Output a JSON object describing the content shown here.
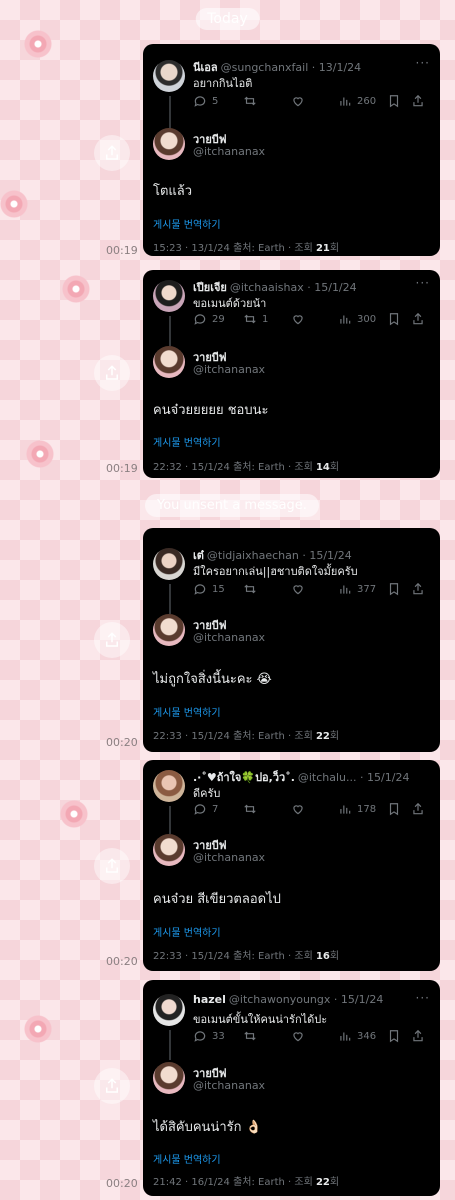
{
  "date_divider": "Today",
  "unsent_notice": "You unsent a message.",
  "cards": [
    {
      "time": "00:19",
      "quoted": {
        "name": "นีเอล",
        "handle": "@sungchanxfail",
        "date": "13/1/24",
        "text": "อยากกินไอติ",
        "replies": "5",
        "retweets": "",
        "views": "260"
      },
      "reply": {
        "name": "วายบีฟ",
        "handle": "@itchananax",
        "text": "โตแล้ว",
        "translate": "게시물 번역하기",
        "meta_prefix": "15:23 · 13/1/24 출처: Earth · 조회 ",
        "views": "21",
        "meta_suffix": "회"
      }
    },
    {
      "time": "00:19",
      "quoted": {
        "name": "เปียเจีย",
        "handle": "@itchaaishax",
        "date": "15/1/24",
        "text": "ขอเมนต์ด้วยน้า",
        "replies": "29",
        "retweets": "1",
        "views": "300"
      },
      "reply": {
        "name": "วายบีฟ",
        "handle": "@itchananax",
        "text": "คนจ๋วยยยยย ชอบนะ",
        "translate": "게시물 번역하기",
        "meta_prefix": "22:32 · 15/1/24 출처: Earth · 조회 ",
        "views": "14",
        "meta_suffix": "회"
      }
    },
    {
      "time": "00:20",
      "quoted": {
        "name": "เต๋",
        "handle": "@tidjaixhaechan",
        "date": "15/1/24",
        "text": "มีใครอยากเล่น||ฮชาบติดใจมั้ยครับ",
        "replies": "15",
        "retweets": "",
        "views": "377"
      },
      "reply": {
        "name": "วายบีฟ",
        "handle": "@itchananax",
        "text": "ไม่ถูกใจสิ่งนี้นะคะ 😭",
        "translate": "게시물 번역하기",
        "meta_prefix": "22:33 · 15/1/24 출처: Earth · 조회 ",
        "views": "22",
        "meta_suffix": "회"
      }
    },
    {
      "time": "00:20",
      "quoted": {
        "name": ".·˚♥ถ้าใจ🍀ปอ,ว็ว˚.",
        "handle": "@itchalu...",
        "date": "15/1/24",
        "text": "ดีครับ",
        "replies": "7",
        "retweets": "",
        "views": "178"
      },
      "reply": {
        "name": "วายบีฟ",
        "handle": "@itchananax",
        "text": "คนจ๋วย สีเขียวตลอดไป",
        "translate": "게시물 번역하기",
        "meta_prefix": "22:33 · 15/1/24 출처: Earth · 조회 ",
        "views": "16",
        "meta_suffix": "회"
      }
    },
    {
      "time": "00:20",
      "quoted": {
        "name": "hazel",
        "handle": "@itchawonyoungx",
        "date": "15/1/24",
        "text": "ขอเมนต์ขั้นให้คนน่ารักได้ปะ",
        "replies": "33",
        "retweets": "",
        "views": "346"
      },
      "reply": {
        "name": "วายบีฟ",
        "handle": "@itchananax",
        "text": "ได้สิคับคนน่ารัก 👌🏻",
        "translate": "게시물 번역하기",
        "meta_prefix": "21:42 · 16/1/24 출처: Earth · 조회 ",
        "views": "22",
        "meta_suffix": "회"
      }
    }
  ],
  "colors": {
    "card_bg": "#000000",
    "link": "#1d9bf0",
    "muted": "#71767b",
    "pink_bg": "#fbe7ea"
  },
  "icons": {
    "share": "share-icon",
    "reply": "reply-icon",
    "retweet": "retweet-icon",
    "like": "heart-icon",
    "views": "views-icon",
    "bookmark": "bookmark-icon",
    "more": "more-icon"
  }
}
